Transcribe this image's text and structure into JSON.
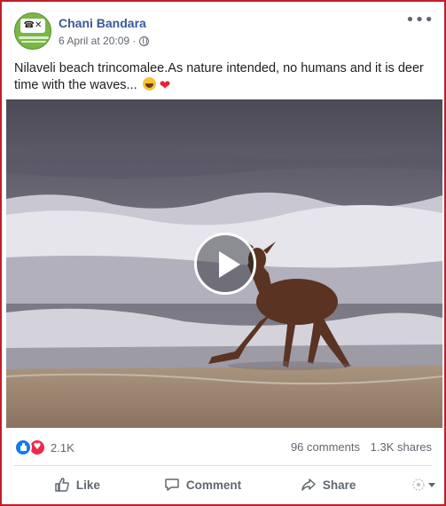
{
  "post": {
    "author": "Chani Bandara",
    "timestamp": "6 April at 20:09 ·",
    "caption": "Nilaveli beach trincomalee.As nature intended, no humans and it is deer time with the waves...",
    "avatar_text": "☎✕"
  },
  "stats": {
    "reaction_count": "2.1K",
    "comments": "96 comments",
    "shares": "1.3K shares"
  },
  "actions": {
    "like": "Like",
    "comment": "Comment",
    "share": "Share"
  },
  "colors": {
    "author_link": "#385898",
    "like_blue": "#1877f2",
    "love_red": "#f02849",
    "border": "#c0202a"
  },
  "icons": [
    "globe-icon",
    "more-icon",
    "play-icon",
    "like-icon",
    "love-icon",
    "thumbs-up-icon",
    "comment-icon",
    "share-icon",
    "audience-icon",
    "caret-down-icon"
  ]
}
